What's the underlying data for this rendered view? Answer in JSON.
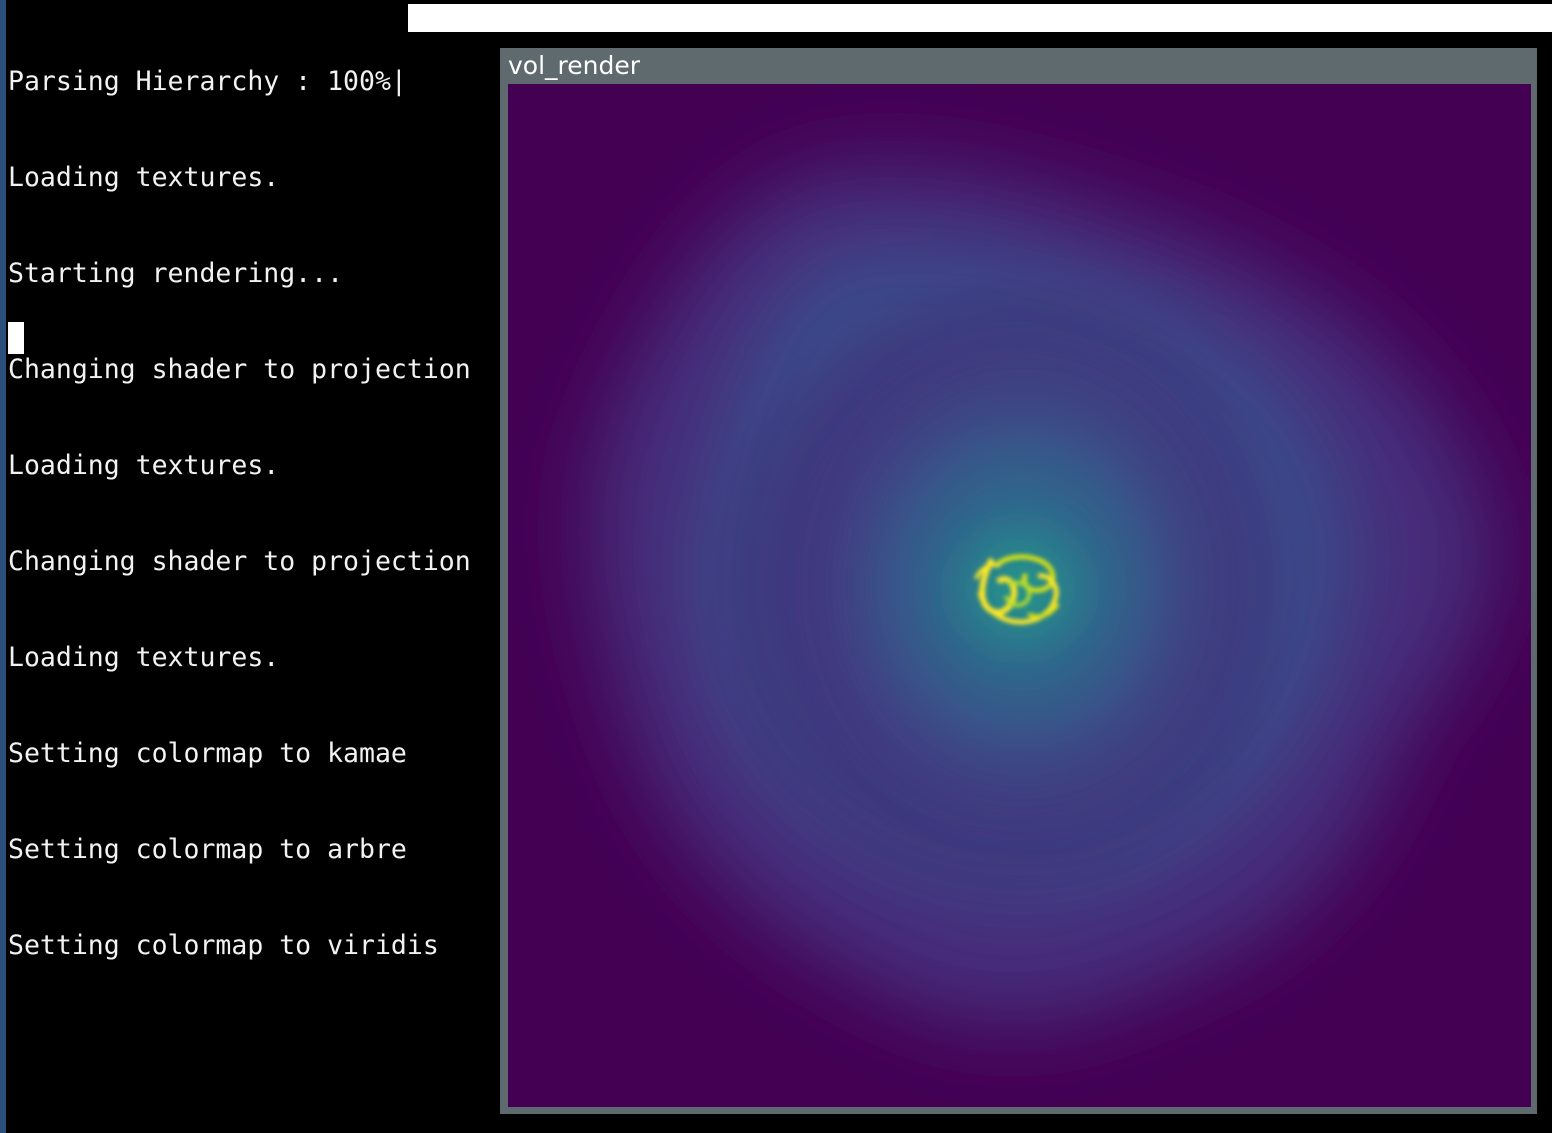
{
  "terminal": {
    "progress_label": "Parsing Hierarchy : 100%|",
    "progress_fraction": 1.0,
    "lines": [
      "Loading textures.",
      "Starting rendering...",
      "Changing shader to projection",
      "Loading textures.",
      "Changing shader to projection",
      "Loading textures.",
      "Setting colormap to kamae",
      "Setting colormap to arbre",
      "Setting colormap to viridis"
    ]
  },
  "window": {
    "title": "vol_render",
    "colormap_colors": {
      "background": "#440154",
      "low": "#482878",
      "mid_low": "#3e4989",
      "mid": "#31688e",
      "mid_high": "#26828e",
      "high": "#1f9e89",
      "peak": "#fde725"
    }
  }
}
